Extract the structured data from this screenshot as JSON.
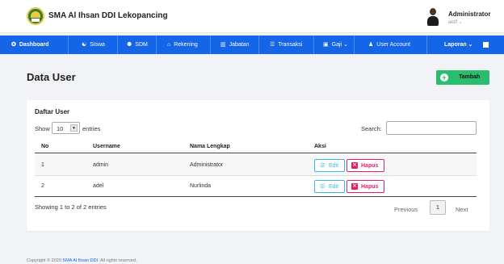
{
  "header": {
    "app_title": "SMA Al Ihsan DDI Lekopancing",
    "user_name": "Administrator",
    "user_status": "aktif ⌄"
  },
  "nav": {
    "items": [
      {
        "icon": "dashboard-icon",
        "glyph": "✪",
        "label": "Dashboard"
      },
      {
        "icon": "users-icon",
        "glyph": "👥",
        "label": "Siswa"
      },
      {
        "icon": "teacher-icon",
        "glyph": "⚉",
        "label": "SDM"
      },
      {
        "icon": "bank-icon",
        "glyph": "🏛",
        "label": "Rekening"
      },
      {
        "icon": "chart-icon",
        "glyph": "▥",
        "label": "Jabatan"
      },
      {
        "icon": "cart-icon",
        "glyph": "🛒",
        "label": "Transaksi"
      },
      {
        "icon": "wallet-icon",
        "glyph": "▣",
        "label": "Gaji ⌄"
      },
      {
        "icon": "user-icon",
        "glyph": "👤",
        "label": "User Account"
      },
      {
        "icon": "report-icon",
        "glyph": "",
        "label": "Laporan ⌄"
      }
    ],
    "accent": "#1565e8"
  },
  "page": {
    "title": "Data User",
    "add_label": "Tambah",
    "add_icon": "plus-icon"
  },
  "card": {
    "title": "Daftar User",
    "show_label": "Show",
    "page_size": "10",
    "entries_label": "entries",
    "search_label": "Search:",
    "search_value": "",
    "columns": [
      "No",
      "Username",
      "Nama Lengkap",
      "Aksi"
    ],
    "rows": [
      {
        "no": "1",
        "username": "admin",
        "nama": "Administrator"
      },
      {
        "no": "2",
        "username": "adel",
        "nama": "Nurlinda"
      }
    ],
    "edit_label": "Edit",
    "delete_label": "Hapus",
    "info": "Showing 1 to 2 of 2 entries",
    "prev_label": "Previous",
    "current_page": "1",
    "next_label": "Next"
  },
  "footer": {
    "prefix": "Copyright © 2020",
    "link": "SMA Al Ihsan DDI",
    "suffix": ". All rights reserved."
  },
  "colors": {
    "nav": "#1565e8",
    "add_button": "#2bbd6e",
    "edit": "#36b9e9",
    "delete": "#e91e63"
  }
}
